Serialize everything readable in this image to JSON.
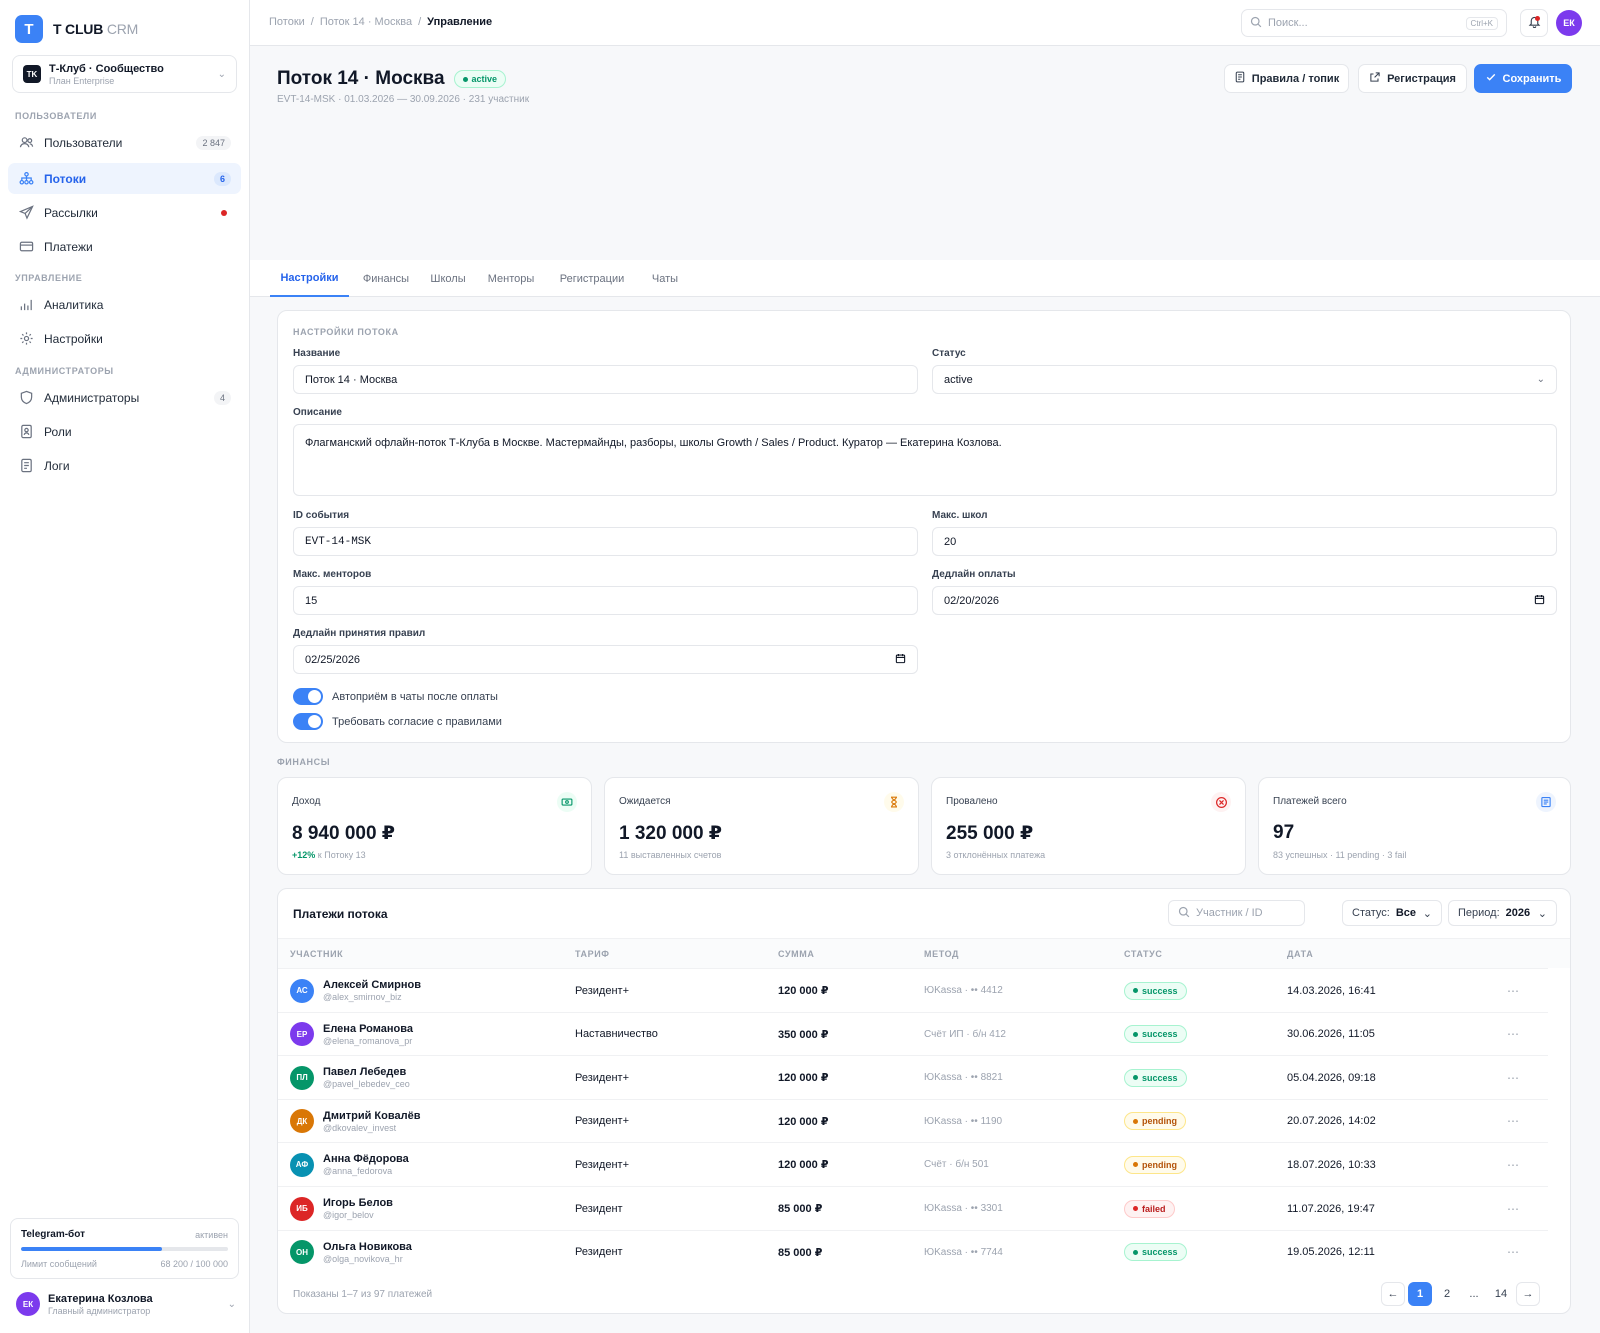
{
  "app": {
    "logo_letter": "T",
    "brand": "T CLUB",
    "brand_suffix": "CRM"
  },
  "org": {
    "badge": "TK",
    "name": "Т-Клуб · Сообщество",
    "plan": "План Enterprise"
  },
  "sidebar": {
    "sections": [
      "ПОЛЬЗОВАТЕЛИ",
      "УПРАВЛЕНИЕ",
      "АДМИНИСТРАТОРЫ"
    ],
    "items": [
      {
        "label": "Пользователи",
        "badge": "2 847",
        "icon": "users-icon"
      },
      {
        "label": "Потоки",
        "badge": "6",
        "icon": "streams-icon"
      },
      {
        "label": "Рассылки",
        "icon": "send-icon"
      },
      {
        "label": "Платежи",
        "icon": "card-icon"
      },
      {
        "label": "Аналитика",
        "icon": "chart-icon"
      },
      {
        "label": "Настройки",
        "icon": "gear-icon"
      },
      {
        "label": "Администраторы",
        "badge": "4",
        "icon": "shield-icon"
      },
      {
        "label": "Роли",
        "icon": "role-icon"
      },
      {
        "label": "Логи",
        "icon": "log-icon"
      }
    ],
    "bot": {
      "title": "Telegram-бот",
      "status": "активен",
      "limit_label": "Лимит сообщений",
      "limit_value": "68 200 / 100 000",
      "usage_fraction": 0.682
    },
    "user": {
      "initials": "ЕК",
      "name": "Екатерина Козлова",
      "role": "Главный администратор"
    }
  },
  "topbar": {
    "breadcrumbs": [
      "Потоки",
      "Поток 14 · Москва",
      "Управление"
    ],
    "search_placeholder": "Поиск...",
    "search_shortcut": "Ctrl+K",
    "avatar": "ЕК"
  },
  "header": {
    "title": "Поток 14 · Москва",
    "status": "active",
    "subtitle": "EVT-14-MSK · 01.03.2026 — 30.09.2026 · 231 участник",
    "actions": {
      "rules": "Правила / топик",
      "registration": "Регистрация",
      "save": "Сохранить"
    }
  },
  "tabs": [
    "Настройки",
    "Финансы",
    "Школы",
    "Менторы",
    "Регистрации",
    "Чаты"
  ],
  "settings": {
    "section_label": "НАСТРОЙКИ ПОТОКА",
    "name_label": "Название",
    "name_value": "Поток 14 · Москва",
    "status_label": "Статус",
    "status_value": "active",
    "description_label": "Описание",
    "description_value": "Флагманский офлайн-поток Т-Клуба в Москве. Мастермайнды, разборы, школы Growth / Sales / Product. Куратор — Екатерина Козлова.",
    "event_id_label": "ID события",
    "event_id_value": "EVT-14-MSK",
    "max_schools_label": "Макс. школ",
    "max_schools_value": "20",
    "max_mentors_label": "Макс. менторов",
    "max_mentors_value": "15",
    "payment_deadline_label": "Дедлайн оплаты",
    "payment_deadline_value": "02/20/2026",
    "rules_deadline_label": "Дедлайн принятия правил",
    "rules_deadline_value": "02/25/2026",
    "toggle_autojoin": "Автоприём в чаты после оплаты",
    "toggle_rules": "Требовать согласие с правилами"
  },
  "finance": {
    "section_label": "ФИНАНСЫ",
    "stats": [
      {
        "label": "Доход",
        "value": "8 940 000 ₽",
        "sub_accent": "+12%",
        "sub": "к Потоку 13"
      },
      {
        "label": "Ожидается",
        "value": "1 320 000 ₽",
        "sub": "11 выставленных счетов"
      },
      {
        "label": "Провалено",
        "value": "255 000 ₽",
        "sub": "3 отклонённых платежа"
      },
      {
        "label": "Платежей всего",
        "value": "97",
        "sub": "83 успешных · 11 pending · 3 fail"
      }
    ]
  },
  "payments": {
    "title": "Платежи потока",
    "search_placeholder": "Участник / ID",
    "status_filter_label": "Статус:",
    "status_filter_value": "Все",
    "period_label": "Период:",
    "period_value": "2026",
    "columns": [
      "УЧАСТНИК",
      "ТАРИФ",
      "СУММА",
      "МЕТОД",
      "СТАТУС",
      "ДАТА"
    ],
    "rows": [
      {
        "initials": "АС",
        "color": "#3b82f6",
        "name": "Алексей Смирнов",
        "handle": "@alex_smirnov_biz",
        "tariff": "Резидент+",
        "amount": "120 000 ₽",
        "method": "ЮKassa · •• 4412",
        "status": "success",
        "date": "14.03.2026, 16:41"
      },
      {
        "initials": "ЕР",
        "color": "#7c3aed",
        "name": "Елена Романова",
        "handle": "@elena_romanova_pr",
        "tariff": "Наставничество",
        "amount": "350 000 ₽",
        "method": "Счёт ИП · б/н 412",
        "status": "success",
        "date": "30.06.2026, 11:05"
      },
      {
        "initials": "ПЛ",
        "color": "#059669",
        "name": "Павел Лебедев",
        "handle": "@pavel_lebedev_ceo",
        "tariff": "Резидент+",
        "amount": "120 000 ₽",
        "method": "ЮKassa · •• 8821",
        "status": "success",
        "date": "05.04.2026, 09:18"
      },
      {
        "initials": "ДК",
        "color": "#d97706",
        "name": "Дмитрий Ковалёв",
        "handle": "@dkovalev_invest",
        "tariff": "Резидент+",
        "amount": "120 000 ₽",
        "method": "ЮKassa · •• 1190",
        "status": "pending",
        "date": "20.07.2026, 14:02"
      },
      {
        "initials": "АФ",
        "color": "#0891b2",
        "name": "Анна Фёдорова",
        "handle": "@anna_fedorova",
        "tariff": "Резидент+",
        "amount": "120 000 ₽",
        "method": "Счёт · б/н 501",
        "status": "pending",
        "date": "18.07.2026, 10:33"
      },
      {
        "initials": "ИБ",
        "color": "#dc2626",
        "name": "Игорь Белов",
        "handle": "@igor_belov",
        "tariff": "Резидент",
        "amount": "85 000 ₽",
        "method": "ЮKassa · •• 3301",
        "status": "failed",
        "date": "11.07.2026, 19:47"
      },
      {
        "initials": "ОН",
        "color": "#059669",
        "name": "Ольга Новикова",
        "handle": "@olga_novikova_hr",
        "tariff": "Резидент",
        "amount": "85 000 ₽",
        "method": "ЮKassa · •• 7744",
        "status": "success",
        "date": "19.05.2026, 12:11"
      }
    ],
    "footer": "Показаны 1–7 из 97 платежей",
    "pagination": [
      "←",
      "1",
      "2",
      "...",
      "14",
      "→"
    ]
  },
  "colors": {
    "accent": "#3b82f6",
    "success": "#059669",
    "pending": "#d97706",
    "failed": "#dc2626"
  }
}
